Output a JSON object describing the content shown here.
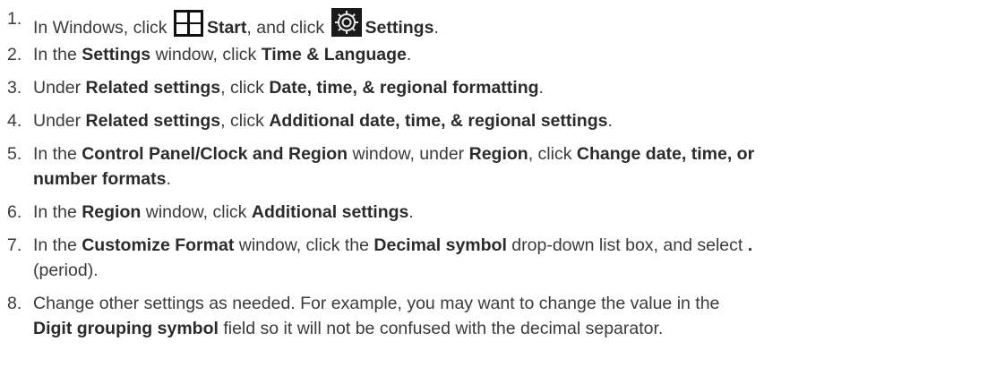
{
  "steps": [
    {
      "number": "1.",
      "t1": "In Windows, click ",
      "b1": "Start",
      "t2": ", and click ",
      "b2": "Settings",
      "t3": "."
    },
    {
      "number": "2.",
      "t1": "In the ",
      "b1": "Settings",
      "t2": " window, click ",
      "b2": "Time & Language",
      "t3": "."
    },
    {
      "number": "3.",
      "t1": "Under ",
      "b1": "Related settings",
      "t2": ", click ",
      "b2": "Date, time, & regional formatting",
      "t3": "."
    },
    {
      "number": "4.",
      "t1": "Under ",
      "b1": "Related settings",
      "t2": ", click ",
      "b2": "Additional date, time, & regional settings",
      "t3": "."
    },
    {
      "number": "5.",
      "t1": "In the ",
      "b1": "Control Panel/Clock and Region",
      "t2": " window, under ",
      "b2": "Region",
      "t3": ", click ",
      "b3": "Change date, time, or",
      "b3_cont": "number formats",
      "t4": "."
    },
    {
      "number": "6.",
      "t1": "In the ",
      "b1": "Region",
      "t2": " window, click ",
      "b2": "Additional settings",
      "t3": "."
    },
    {
      "number": "7.",
      "t1": "In the ",
      "b1": "Customize Format",
      "t2": " window, click the ",
      "b2": "Decimal symbol",
      "t3": " drop-down list box, and select ",
      "b3": ".",
      "t4_cont": "(period)."
    },
    {
      "number": "8.",
      "t1": "Change other settings as needed. For example, you may want to change the value in the",
      "b1_cont": "Digit grouping symbol",
      "t2_cont": " field so it will not be confused with the decimal separator."
    }
  ],
  "icons": {
    "start": "windows-start-icon",
    "settings": "gear-icon"
  }
}
